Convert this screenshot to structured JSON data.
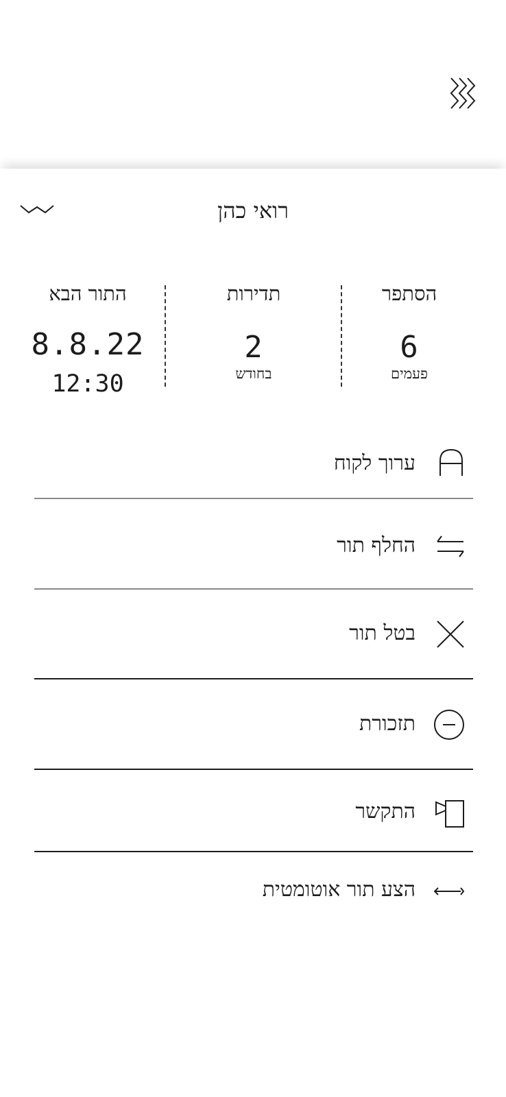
{
  "header": {
    "menu_icon": "menu-icon",
    "collapse_icon": "chevron-down-icon",
    "customer_name": "רואי כהן"
  },
  "stats": {
    "haircuts": {
      "title": "הסתפר",
      "value": "6",
      "unit": "פעמים"
    },
    "frequency": {
      "title": "תדירות",
      "value": "2",
      "unit": "בחודש"
    },
    "next_appointment": {
      "title": "התור הבא",
      "date": "8.8.22",
      "time": "12:30"
    }
  },
  "actions": [
    {
      "label": "ערוך לקוח",
      "icon": "edit-customer-icon"
    },
    {
      "label": "החלף תור",
      "icon": "swap-icon"
    },
    {
      "label": "בטל תור",
      "icon": "close-icon"
    },
    {
      "label": "תזכורת",
      "icon": "reminder-icon"
    },
    {
      "label": "התקשר",
      "icon": "call-icon"
    },
    {
      "label": "הצע תור אוטומטית",
      "icon": "auto-suggest-icon"
    }
  ],
  "colors": {
    "background": "#ffffff",
    "text": "#1c1c1c",
    "divider_light": "#8a8a8a",
    "divider_dark": "#1c1c1c"
  }
}
